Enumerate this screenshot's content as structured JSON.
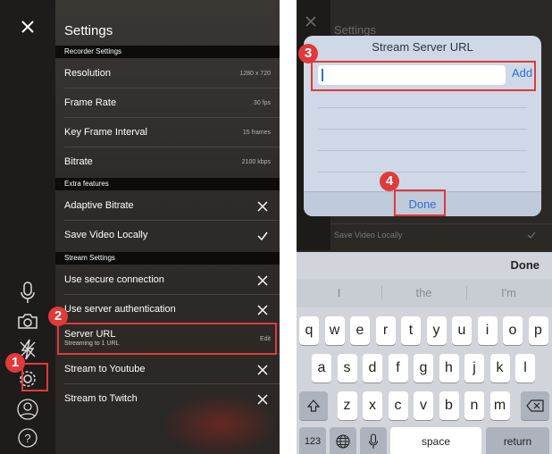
{
  "left_screen": {
    "close_icon": "close-icon",
    "panel_title": "Settings",
    "sections": [
      {
        "header": "Recorder Settings"
      },
      {
        "header": "Extra features"
      },
      {
        "header": "Stream Settings"
      }
    ],
    "rows": {
      "resolution": {
        "label": "Resolution",
        "value": "1280 x 720"
      },
      "frame_rate": {
        "label": "Frame Rate",
        "value": "30 fps"
      },
      "key_frame": {
        "label": "Key Frame Interval",
        "value": "15 frames"
      },
      "bitrate": {
        "label": "Bitrate",
        "value": "2100 kbps"
      },
      "adaptive_bitrate": {
        "label": "Adaptive Bitrate",
        "icon": "x-icon"
      },
      "save_video": {
        "label": "Save Video Locally",
        "icon": "check-icon"
      },
      "secure_connection": {
        "label": "Use secure connection",
        "icon": "x-icon"
      },
      "server_auth": {
        "label": "Use server authentication",
        "icon": "x-icon"
      },
      "server_url": {
        "label": "Server URL",
        "sublabel": "Streaming to 1 URL",
        "action": "Edit"
      },
      "youtube": {
        "label": "Stream to Youtube",
        "icon": "x-icon"
      },
      "twitch": {
        "label": "Stream to Twitch",
        "icon": "x-icon"
      }
    },
    "rail_icons": [
      "microphone-icon",
      "camera-switch-icon",
      "flash-off-icon",
      "gear-icon",
      "user-icon",
      "help-icon"
    ],
    "help_glyph": "?"
  },
  "right_screen": {
    "dimmed_title": "Settings",
    "dimmed_row": "Save Video Locally",
    "dialog": {
      "title": "Stream Server URL",
      "input_value": "",
      "add_label": "Add",
      "done_label": "Done"
    },
    "keyboard": {
      "done_label": "Done",
      "predictions": [
        "I",
        "the",
        "I'm"
      ],
      "row1": [
        "q",
        "w",
        "e",
        "r",
        "t",
        "y",
        "u",
        "i",
        "o",
        "p"
      ],
      "row2": [
        "a",
        "s",
        "d",
        "f",
        "g",
        "h",
        "j",
        "k",
        "l"
      ],
      "row3": [
        "z",
        "x",
        "c",
        "v",
        "b",
        "n",
        "m"
      ],
      "numbers_label": "123",
      "space_label": "space",
      "return_label": "return"
    }
  },
  "callouts": [
    "1",
    "2",
    "3",
    "4"
  ],
  "colors": {
    "accent_red": "#e03a3a",
    "ios_blue": "#2e6fd2"
  }
}
